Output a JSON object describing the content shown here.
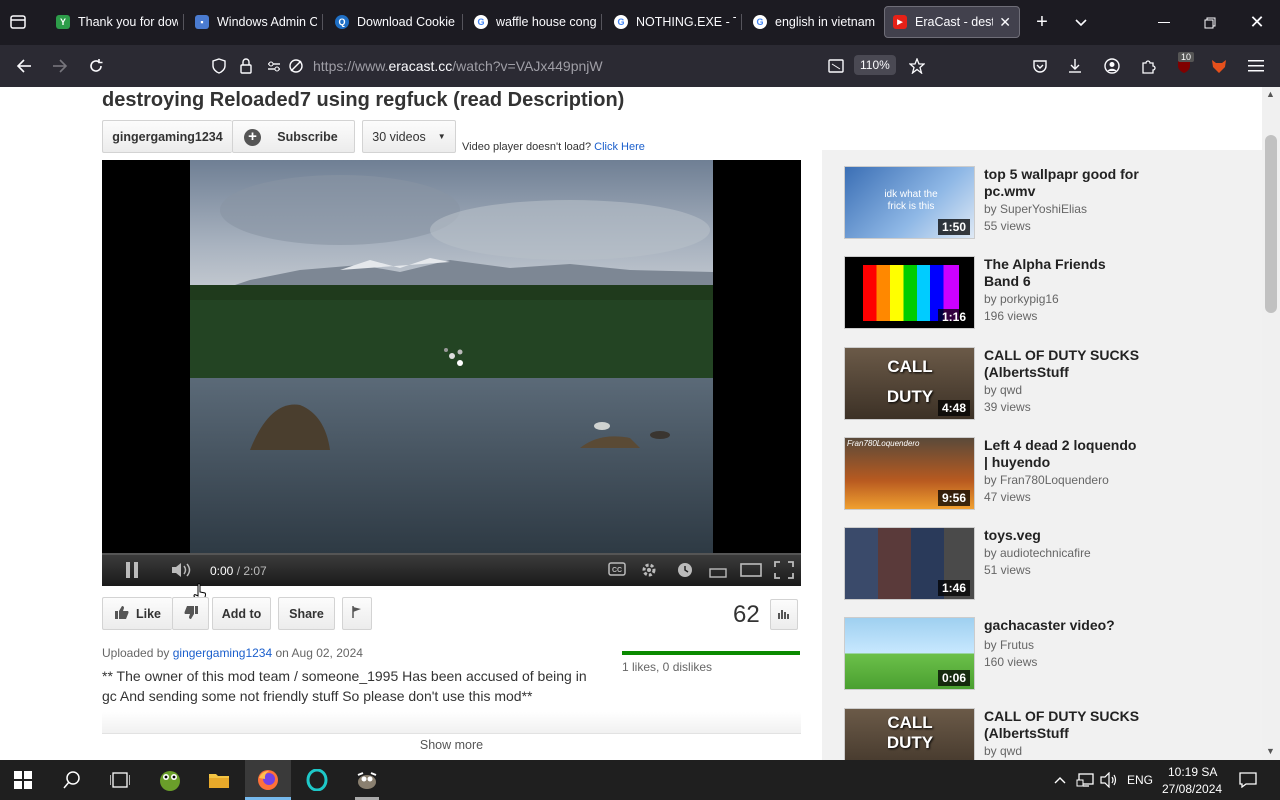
{
  "tabs": [
    {
      "title": "Thank you for dow",
      "favicon": "Y",
      "favcolor": "#2d9d4a",
      "active": false
    },
    {
      "title": "Windows Admin C",
      "favicon": "▪",
      "favcolor": "#4a7bd0",
      "active": false
    },
    {
      "title": "Download Cookie",
      "favicon": "Q",
      "favcolor": "#1f6fc5",
      "active": false
    },
    {
      "title": "waffle house cong",
      "favicon": "G",
      "favcolor": "#ffffff",
      "active": false
    },
    {
      "title": "NOTHING.EXE - Ti",
      "favicon": "G",
      "favcolor": "#ffffff",
      "active": false
    },
    {
      "title": "english in vietnam",
      "favicon": "G",
      "favcolor": "#ffffff",
      "active": false
    },
    {
      "title": "EraCast - destro",
      "favicon": "▶",
      "favcolor": "#e62117",
      "active": true
    }
  ],
  "nav": {
    "url_prefix": "https://www.",
    "url_domain": "eracast.cc",
    "url_rest": "/watch?v=VAJx449pnjW",
    "zoom": "110%",
    "extension_badge": "10"
  },
  "video": {
    "title": "destroying Reloaded7 using regfuck (read Description)",
    "channel": "gingergaming1234",
    "subscribe_label": "Subscribe",
    "videos_count_label": "30 videos",
    "player_notice": "Video player doesn't load?",
    "player_notice_link": "Click Here",
    "time_current": "0:00",
    "time_total": "/ 2:07",
    "like_label": "Like",
    "add_to_label": "Add to",
    "share_label": "Share",
    "view_count": "62",
    "uploaded_prefix": "Uploaded by",
    "uploader": "gingergaming1234",
    "upload_date": "on Aug 02, 2024",
    "likes_text": "1 likes, 0 dislikes",
    "description_line1": "** The owner of this mod team / someone_1995 Has been accused of being in",
    "description_line2": "gc And sending some not friendly stuff So please don't use this mod**",
    "show_more": "Show more"
  },
  "related": [
    {
      "title": "top 5 wallpapr good for pc.wmv",
      "by": "by SuperYoshiElias",
      "views": "55 views",
      "duration": "1:50",
      "thumb_text": "idk what the frick is this"
    },
    {
      "title": "The Alpha Friends Band 6",
      "by": "by porkypig16",
      "views": "196 views",
      "duration": "1:16",
      "thumb_text": ""
    },
    {
      "title": "CALL OF DUTY SUCKS (AlbertsStuff",
      "by": "by qwd",
      "views": "39 views",
      "duration": "4:48",
      "thumb_text": "CALL DUTY SUCKS"
    },
    {
      "title": "Left 4 dead 2 loquendo | huyendo",
      "by": "by Fran780Loquendero",
      "views": "47 views",
      "duration": "9:56",
      "thumb_text": "Fran780Loquendero"
    },
    {
      "title": "toys.veg",
      "by": "by audiotechnicafire",
      "views": "51 views",
      "duration": "1:46",
      "thumb_text": ""
    },
    {
      "title": "gachacaster video?",
      "by": "by Frutus",
      "views": "160 views",
      "duration": "0:06",
      "thumb_text": ""
    },
    {
      "title": "CALL OF DUTY SUCKS (AlbertsStuff",
      "by": "by qwd",
      "views": "",
      "duration": "",
      "thumb_text": "CALL DUTY"
    }
  ],
  "taskbar": {
    "lang": "ENG",
    "time": "10:19 SA",
    "date": "27/08/2024"
  }
}
